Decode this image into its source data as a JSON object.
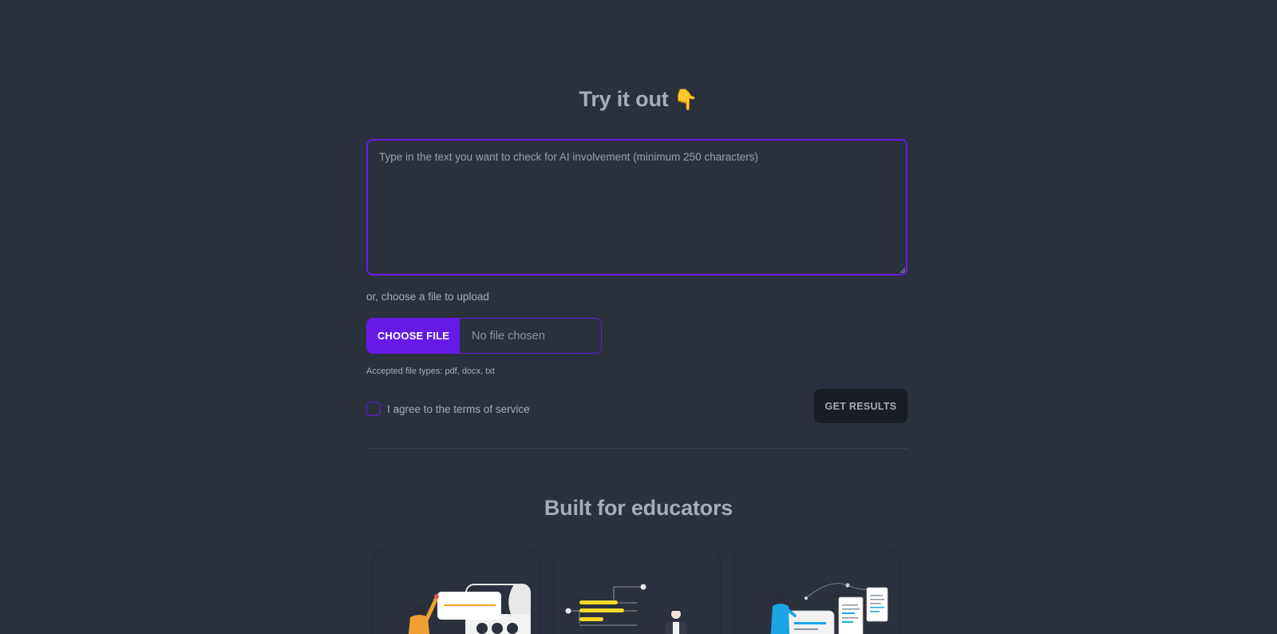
{
  "try_section": {
    "title": "Try it out",
    "emoji": "👇",
    "textarea_placeholder": "Type in the text you want to check for AI involvement (minimum 250 characters)",
    "textarea_value": "",
    "upload_hint": "or, choose a file to upload",
    "choose_file_label": "CHOOSE FILE",
    "file_status": "No file chosen",
    "accepted_types": "Accepted file types: pdf, docx, txt",
    "terms_label": "I agree to the terms of service",
    "terms_checked": false,
    "get_results_label": "GET RESULTS"
  },
  "educators_section": {
    "title": "Built for educators",
    "cards": [
      {
        "illustration": "presenter-illustration"
      },
      {
        "illustration": "timeline-illustration"
      },
      {
        "illustration": "documents-illustration"
      }
    ]
  },
  "colors": {
    "background": "#2a303c",
    "primary": "#661ae6",
    "text": "#a6adba",
    "button_dark": "#191d24",
    "accent_yellow": "#f5c518",
    "accent_orange": "#f0a030",
    "accent_blue": "#1aa6e6"
  }
}
